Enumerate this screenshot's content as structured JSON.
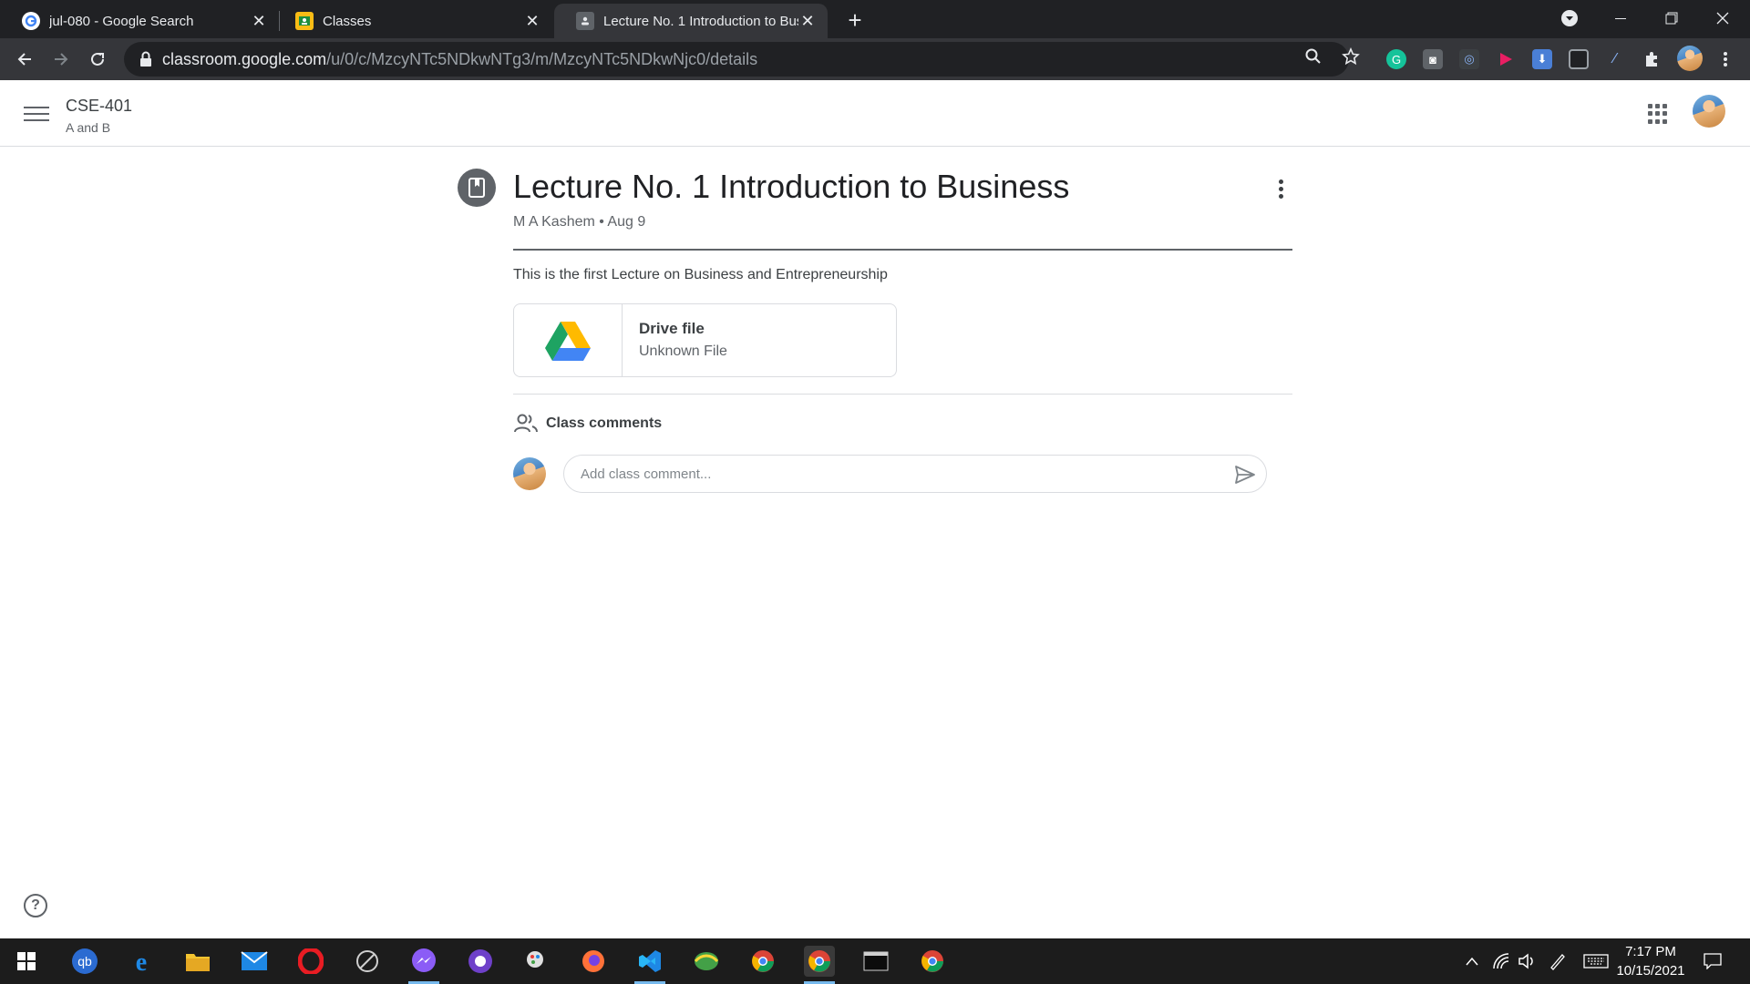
{
  "browser": {
    "tabs": [
      {
        "title": "jul-080 - Google Search",
        "icon": "google-icon"
      },
      {
        "title": "Classes",
        "icon": "classroom-icon"
      },
      {
        "title": "Lecture No. 1 Introduction to Bus",
        "icon": "classroom-post-icon",
        "active": true
      }
    ],
    "url_host": "classroom.google.com",
    "url_path": "/u/0/c/MzcyNTc5NDkwNTg3/m/MzcyNTc5NDkwNjc0/details"
  },
  "classroom": {
    "class_name": "CSE-401",
    "class_section": "A and B"
  },
  "post": {
    "title": "Lecture No. 1 Introduction to Business",
    "meta": "M A Kashem • Aug 9",
    "description": "This is the first Lecture on Business and Entrepreneurship",
    "attachment": {
      "name": "Drive file",
      "type": "Unknown File"
    }
  },
  "comments": {
    "heading": "Class comments",
    "placeholder": "Add class comment..."
  },
  "taskbar": {
    "time": "7:17 PM",
    "date": "10/15/2021"
  },
  "colors": {
    "drive_green": "#1ea362",
    "drive_yellow": "#ffba00",
    "drive_blue": "#4285f4"
  }
}
